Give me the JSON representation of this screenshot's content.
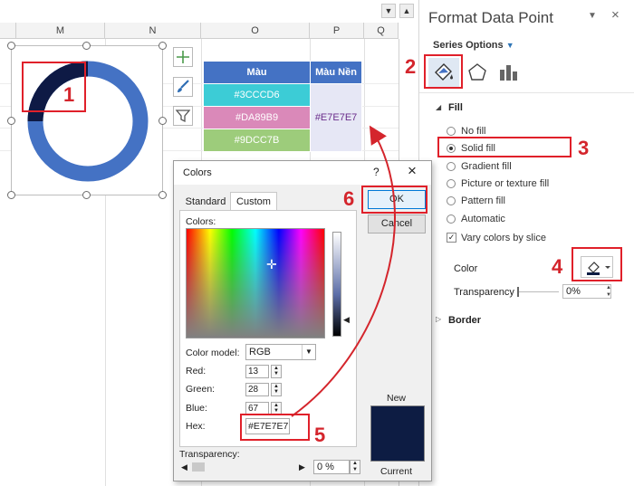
{
  "sheet": {
    "columns": [
      "M",
      "N",
      "O",
      "P",
      "Q"
    ],
    "table": {
      "headers": [
        "Màu",
        "Màu Nền"
      ],
      "rows": [
        {
          "mau": "#3CCCD6",
          "color": "#3CCCD6"
        },
        {
          "mau": "#DA89B9",
          "color": "#DA89B9"
        },
        {
          "mau": "#9DCC7B",
          "color": "#9DCC7B"
        }
      ],
      "mau_nen": "#E7E7E7",
      "mau_nen_bg": "#E6E7F5"
    },
    "chart": {
      "ring_color": "#4472C4",
      "selected_point_color": "#0E1A45",
      "selected_fraction": 0.25
    }
  },
  "pane": {
    "title": "Format Data Point",
    "series_options": "Series Options",
    "fill_header": "Fill",
    "fill_options": [
      {
        "label": "No fill",
        "selected": false
      },
      {
        "label": "Solid fill",
        "selected": true
      },
      {
        "label": "Gradient fill",
        "selected": false
      },
      {
        "label": "Picture or texture fill",
        "selected": false
      },
      {
        "label": "Pattern fill",
        "selected": false
      },
      {
        "label": "Automatic",
        "selected": false
      }
    ],
    "vary_colors": "Vary colors by slice",
    "color_label": "Color",
    "transparency_label": "Transparency",
    "transparency_value": "0%",
    "border_header": "Border"
  },
  "dialog": {
    "title": "Colors",
    "tabs": [
      "Standard",
      "Custom"
    ],
    "colors_label": "Colors:",
    "ok": "OK",
    "cancel": "Cancel",
    "color_model_label": "Color model:",
    "color_model_value": "RGB",
    "red_label": "Red:",
    "red": "13",
    "green_label": "Green:",
    "green": "28",
    "blue_label": "Blue:",
    "blue": "67",
    "hex_label": "Hex:",
    "hex": "#E7E7E7",
    "new_label": "New",
    "current_label": "Current",
    "transparency_label": "Transparency:",
    "transparency_value": "0 %",
    "new_color": "#0D1C43",
    "help": "?",
    "close": "×"
  },
  "steps": [
    "1",
    "2",
    "3",
    "4",
    "5",
    "6"
  ],
  "accent": "#E0202A"
}
